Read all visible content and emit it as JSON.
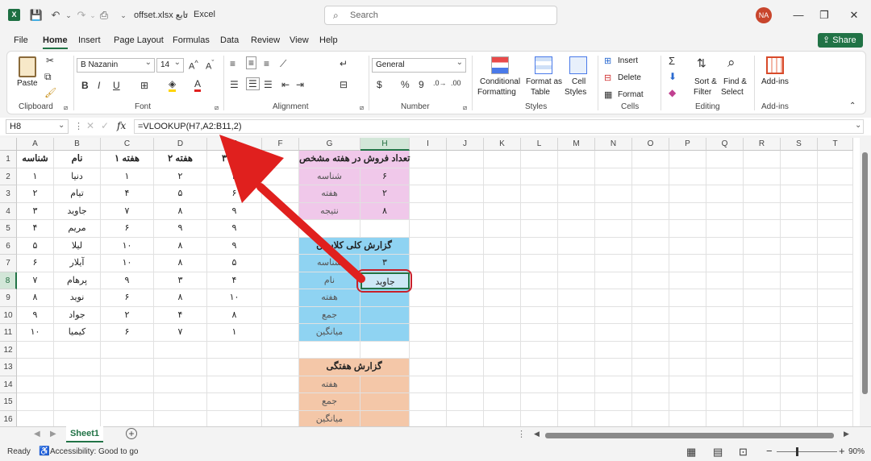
{
  "app": {
    "file_title": "offset.xlsx تابع",
    "app_name": "Excel",
    "search_placeholder": "Search",
    "user_initials": "NA"
  },
  "menu": [
    "File",
    "Home",
    "Insert",
    "Page Layout",
    "Formulas",
    "Data",
    "Review",
    "View",
    "Help"
  ],
  "share_label": "Share",
  "ribbon": {
    "clipboard": {
      "paste": "Paste",
      "label": "Clipboard"
    },
    "font": {
      "name": "B Nazanin",
      "size": "14",
      "label": "Font"
    },
    "alignment": {
      "label": "Alignment"
    },
    "number": {
      "format": "General",
      "label": "Number"
    },
    "styles": {
      "conditional": "Conditional",
      "conditional2": "Formatting",
      "format_as": "Format as",
      "format_as2": "Table",
      "cell": "Cell",
      "cell2": "Styles",
      "label": "Styles"
    },
    "cells": {
      "insert": "Insert",
      "delete": "Delete",
      "format": "Format",
      "label": "Cells"
    },
    "editing": {
      "sort": "Sort &",
      "sort2": "Filter",
      "find": "Find &",
      "find2": "Select",
      "label": "Editing"
    },
    "addins": {
      "label": "Add-ins",
      "label2": "Add-ins"
    }
  },
  "formula_bar": {
    "name_box": "H8",
    "fx": "fx",
    "formula": "=VLOOKUP(H7,A2:B11,2)"
  },
  "columns": [
    "A",
    "B",
    "C",
    "D",
    "E",
    "F",
    "G",
    "H",
    "I",
    "J",
    "K",
    "L",
    "M",
    "N",
    "O",
    "P",
    "Q",
    "R",
    "S",
    "T"
  ],
  "rows": [
    "1",
    "2",
    "3",
    "4",
    "5",
    "6",
    "7",
    "8",
    "9",
    "10",
    "11",
    "12",
    "13",
    "14",
    "15",
    "16"
  ],
  "table_headers": [
    "شناسه",
    "نام",
    "هفته ۱",
    "هفته ۲",
    "هفته ۳"
  ],
  "table_rows": [
    [
      "۱",
      "دنیا",
      "۱",
      "۲",
      "۳"
    ],
    [
      "۲",
      "تیام",
      "۴",
      "۵",
      "۶"
    ],
    [
      "۳",
      "جاوید",
      "۷",
      "۸",
      "۹"
    ],
    [
      "۴",
      "مریم",
      "۶",
      "۹",
      "۹"
    ],
    [
      "۵",
      "لیلا",
      "۱۰",
      "۸",
      "۹"
    ],
    [
      "۶",
      "آیلار",
      "۱۰",
      "۸",
      "۵"
    ],
    [
      "۷",
      "پرهام",
      "۹",
      "۳",
      "۴"
    ],
    [
      "۸",
      "نوید",
      "۶",
      "۸",
      "۱۰"
    ],
    [
      "۹",
      "جواد",
      "۲",
      "۴",
      "۸"
    ],
    [
      "۱۰",
      "کیمیا",
      "۶",
      "۷",
      "۱"
    ]
  ],
  "panel_sales": {
    "title": "تعداد فروش در هفته مشخص",
    "rows": [
      [
        "شناسه",
        "۶"
      ],
      [
        "هفته",
        "۲"
      ],
      [
        "نتیجه",
        "۸"
      ]
    ]
  },
  "panel_report": {
    "title": "گزارش کلی کلاسان",
    "rows": [
      [
        "شناسه",
        "۳"
      ],
      [
        "نام",
        "جاوید"
      ],
      [
        "هفته",
        ""
      ],
      [
        "جمع",
        ""
      ],
      [
        "میانگین",
        ""
      ]
    ]
  },
  "panel_weekly": {
    "title": "گزارش هفتگی",
    "rows": [
      "هفته",
      "جمع",
      "میانگین"
    ]
  },
  "sheet_tab": "Sheet1",
  "status": {
    "ready": "Ready",
    "accessibility": "Accessibility: Good to go",
    "zoom": "90%"
  },
  "colors": {
    "accent": "#217346",
    "pink": "#f0c8ea",
    "blue": "#8fd3f2",
    "peach": "#f4c7a8",
    "arrow": "#e0201e"
  }
}
